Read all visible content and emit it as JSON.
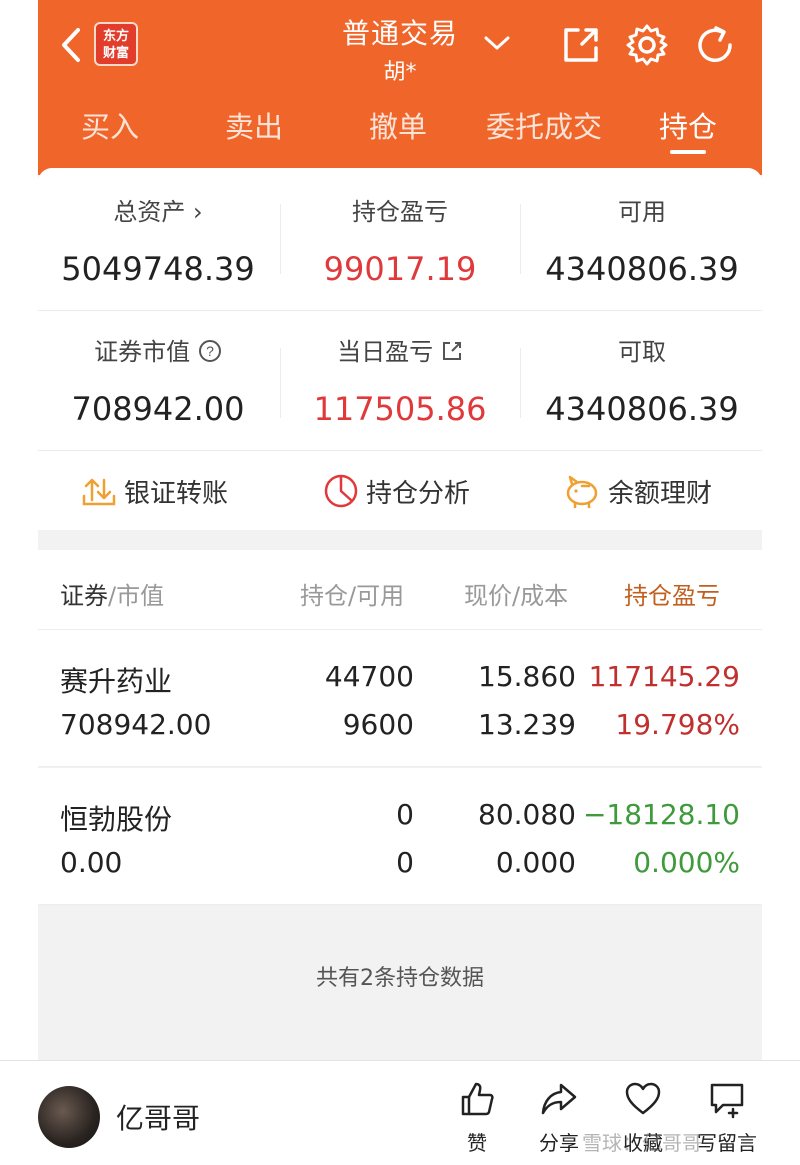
{
  "header": {
    "logo_text": "东方财富",
    "title": "普通交易",
    "subtitle": "胡*",
    "tabs": [
      "买入",
      "卖出",
      "撤单",
      "委托成交",
      "持仓"
    ]
  },
  "summary": {
    "total_assets_label": "总资产 ›",
    "total_assets": "5049748.39",
    "position_pnl_label": "持仓盈亏",
    "position_pnl": "99017.19",
    "available_label": "可用",
    "available": "4340806.39",
    "market_value_label": "证券市值",
    "market_value": "708942.00",
    "daily_pnl_label": "当日盈亏",
    "daily_pnl": "117505.86",
    "withdrawable_label": "可取",
    "withdrawable": "4340806.39"
  },
  "quick_actions": [
    "银证转账",
    "持仓分析",
    "余额理财"
  ],
  "table": {
    "headers": {
      "col1_main": "证券",
      "col1_sub": "/市值",
      "col2": "持仓/可用",
      "col3": "现价/成本",
      "col4": "持仓盈亏"
    },
    "rows": [
      {
        "name": "赛升药业",
        "market_value": "708942.00",
        "position": "44700",
        "available": "9600",
        "price": "15.860",
        "cost": "13.239",
        "pnl": "117145.29",
        "pnl_pct": "19.798%"
      },
      {
        "name": "恒勃股份",
        "market_value": "0.00",
        "position": "0",
        "available": "0",
        "price": "80.080",
        "cost": "0.000",
        "pnl": "−18128.10",
        "pnl_pct": "0.000%"
      }
    ],
    "footer": "共有2条持仓数据"
  },
  "bottom_bar": {
    "username": "亿哥哥",
    "actions": [
      "赞",
      "分享",
      "收藏",
      "写留言"
    ],
    "watermark": "雪球：亿哥哥"
  },
  "colors": {
    "brand": "#f0652a",
    "up": "#c0302f",
    "down": "#3e9a3a",
    "red_value": "#e0393b"
  }
}
